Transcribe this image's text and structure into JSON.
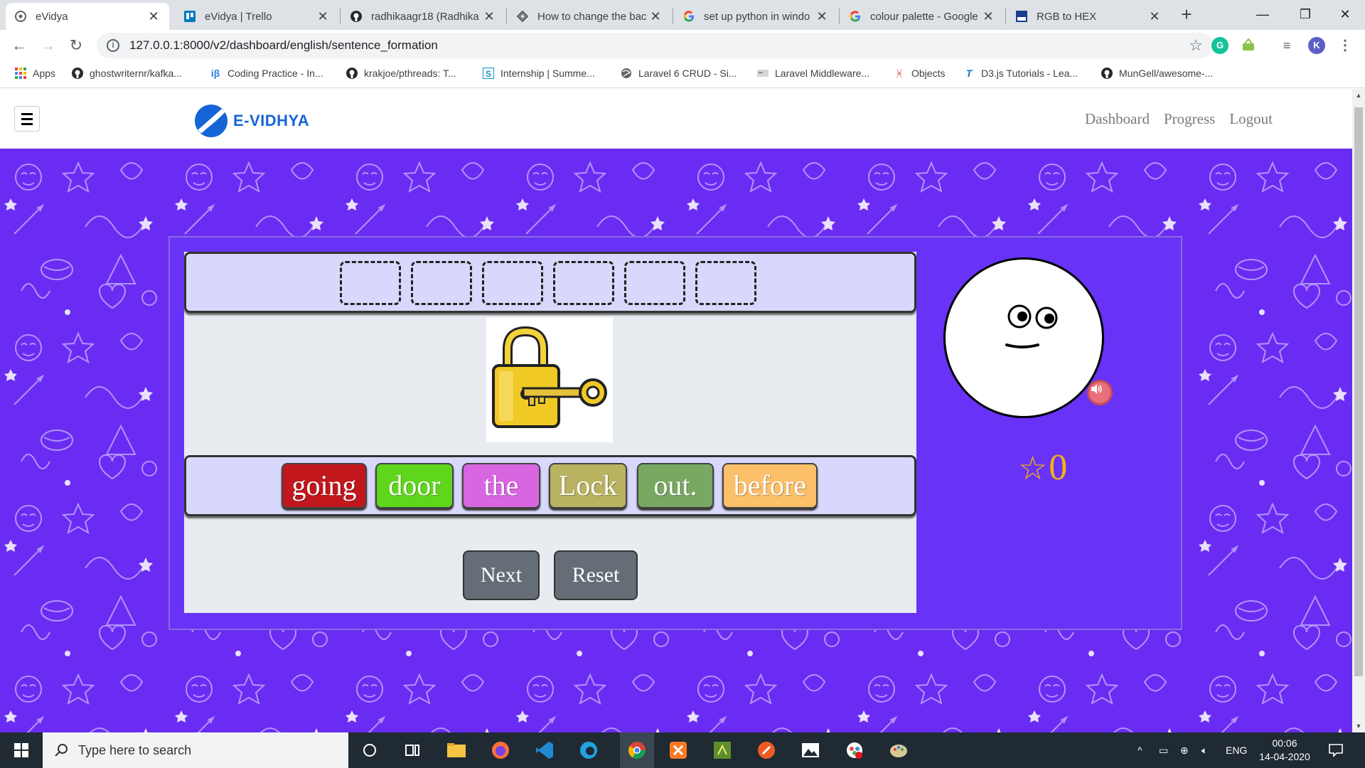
{
  "browser": {
    "tabs": [
      {
        "title": "eVidya",
        "active": true
      },
      {
        "title": "eVidya | Trello"
      },
      {
        "title": "radhikaagr18 (Radhika"
      },
      {
        "title": "How to change the bac"
      },
      {
        "title": "set up python in windo"
      },
      {
        "title": "colour palette - Google"
      },
      {
        "title": "RGB to HEX"
      }
    ],
    "new_tab": "+",
    "url": "127.0.0.1:8000/v2/dashboard/english/sentence_formation",
    "profile_initial": "K",
    "bookmarks": [
      "Apps",
      "ghostwriternr/kafka...",
      "Coding Practice - In...",
      "krakjoe/pthreads: T...",
      "Internship | Summe...",
      "Laravel 6 CRUD - Si...",
      "Laravel Middleware...",
      "Objects",
      "D3.js Tutorials - Lea...",
      "MunGell/awesome-..."
    ]
  },
  "site": {
    "brand": "E-VIDHYA",
    "nav": [
      "Dashboard",
      "Progress",
      "Logout"
    ]
  },
  "game": {
    "answer_slots": 6,
    "picture": "padlock-with-key",
    "words": [
      {
        "text": "going",
        "color": "#c1171d"
      },
      {
        "text": "door",
        "color": "#5fd61c"
      },
      {
        "text": "the",
        "color": "#d866e0"
      },
      {
        "text": "Lock",
        "color": "#b8b261"
      },
      {
        "text": "out.",
        "color": "#78a862"
      },
      {
        "text": "before",
        "color": "#fcbf6a"
      }
    ],
    "buttons": {
      "next": "Next",
      "reset": "Reset"
    },
    "score": {
      "star": "☆",
      "value": "0"
    },
    "colors": {
      "background": "#6a2cf2",
      "strip": "#d8d8fc",
      "score": "#f2b705"
    }
  },
  "taskbar": {
    "search_placeholder": "Type here to search",
    "language": "ENG",
    "time": "00:06",
    "date": "14-04-2020"
  }
}
